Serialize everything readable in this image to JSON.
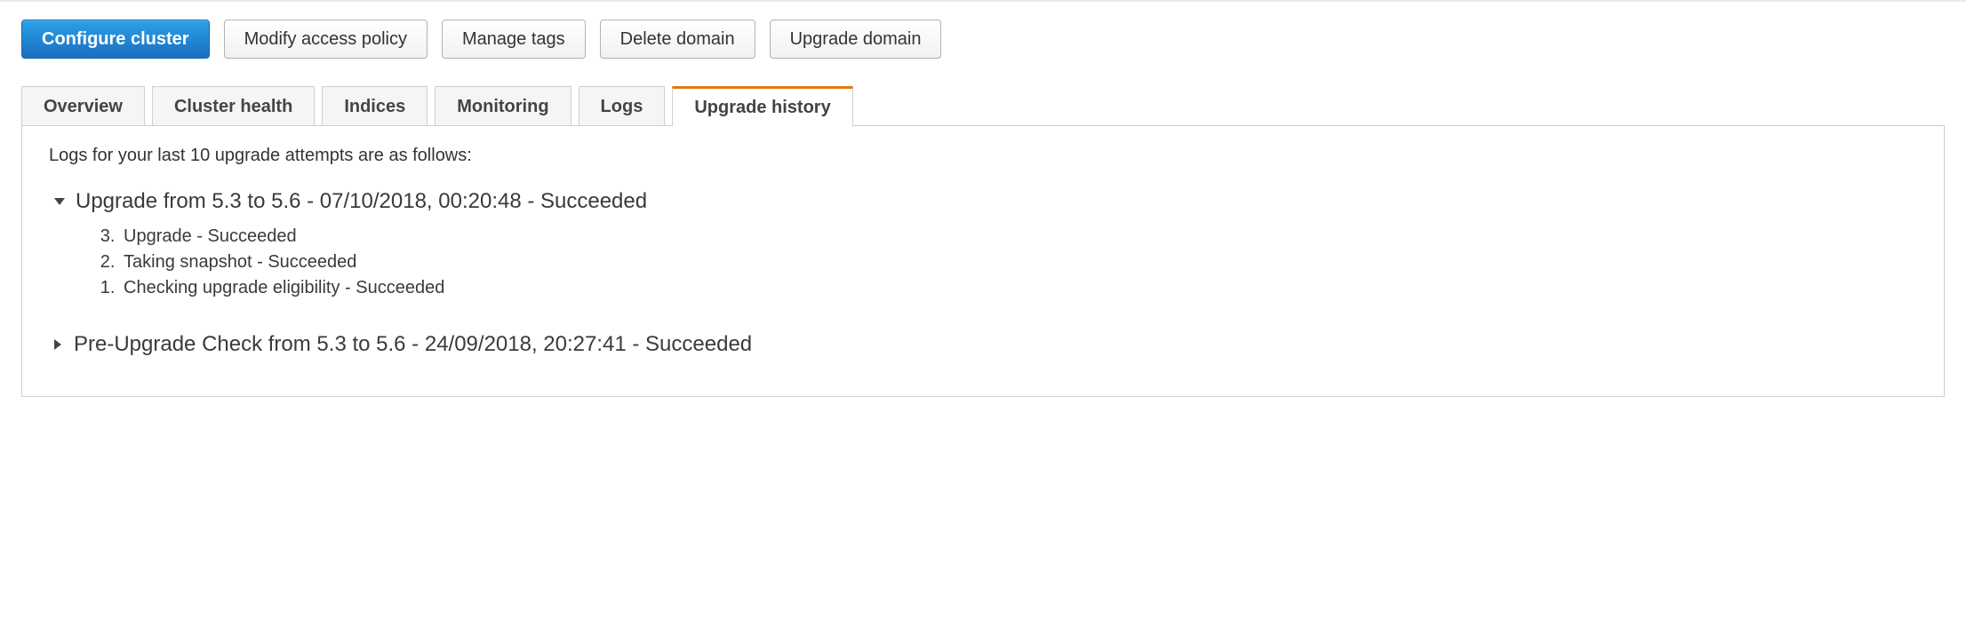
{
  "toolbar": {
    "configure": "Configure cluster",
    "modify_policy": "Modify access policy",
    "manage_tags": "Manage tags",
    "delete_domain": "Delete domain",
    "upgrade_domain": "Upgrade domain"
  },
  "tabs": {
    "overview": "Overview",
    "cluster_health": "Cluster health",
    "indices": "Indices",
    "monitoring": "Monitoring",
    "logs": "Logs",
    "upgrade_history": "Upgrade history"
  },
  "content": {
    "intro": "Logs for your last 10 upgrade attempts are as follows:",
    "entries": [
      {
        "title": "Upgrade from 5.3 to 5.6 - 07/10/2018, 00:20:48 - Succeeded",
        "expanded": true,
        "steps": [
          "Checking upgrade eligibility - Succeeded",
          "Taking snapshot - Succeeded",
          "Upgrade - Succeeded"
        ]
      },
      {
        "title": "Pre-Upgrade Check from 5.3 to 5.6 - 24/09/2018, 20:27:41 - Succeeded",
        "expanded": false
      }
    ]
  }
}
